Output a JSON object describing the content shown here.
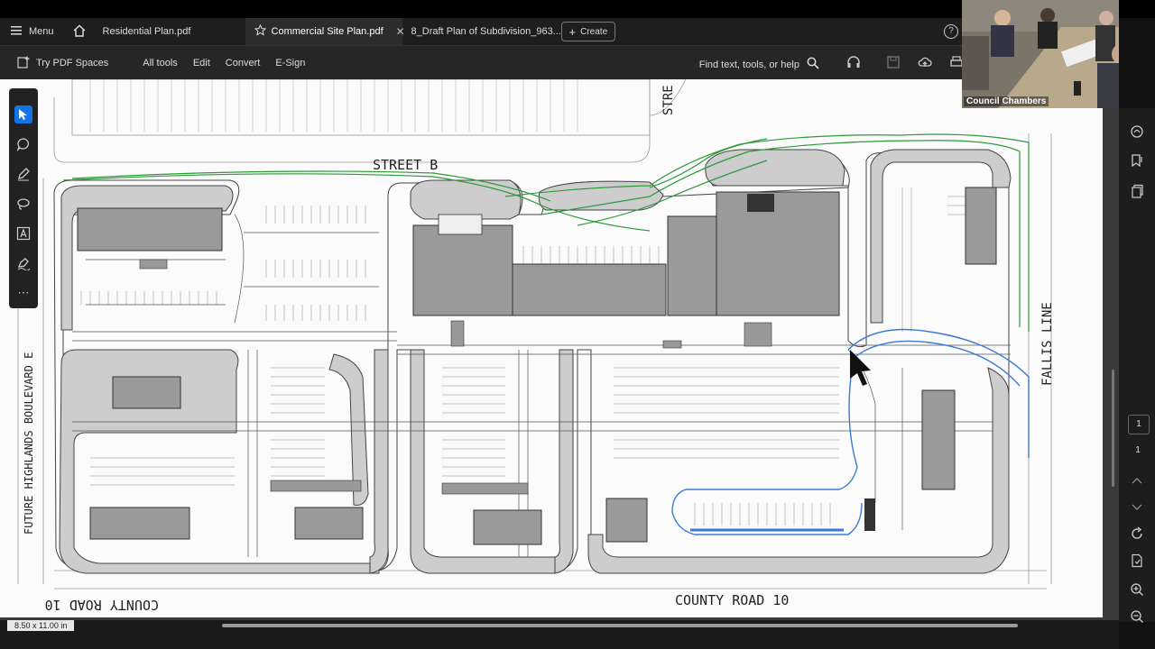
{
  "tabs": {
    "menu_label": "Menu",
    "items": [
      {
        "label": "Residential Plan.pdf"
      },
      {
        "label": "Commercial Site Plan.pdf"
      },
      {
        "label": "8_Draft Plan of Subdivision_963..."
      }
    ],
    "create_label": "Create"
  },
  "toolbar": {
    "spaces_label": "Try PDF Spaces",
    "all_tools": "All tools",
    "edit": "Edit",
    "convert": "Convert",
    "esign": "E-Sign",
    "find_label": "Find text, tools, or help"
  },
  "plan": {
    "street_b": "STREET B",
    "street_top": "STRE",
    "fallis_line": "FALLIS LINE",
    "future_blvd": "FUTURE HIGHLANDS BOULEVARD E",
    "county_road_left": "COUNTY ROAD 10",
    "county_road_right": "COUNTY ROAD 10"
  },
  "navigation": {
    "current_page": "1",
    "total_pages": "1"
  },
  "status": {
    "page_size": "8.50 x 11.00 in"
  },
  "video": {
    "label": "Council Chambers"
  },
  "colors": {
    "accent": "#1473e6",
    "plan_green": "#2e9a3a",
    "plan_blue": "#3a7ad6"
  }
}
